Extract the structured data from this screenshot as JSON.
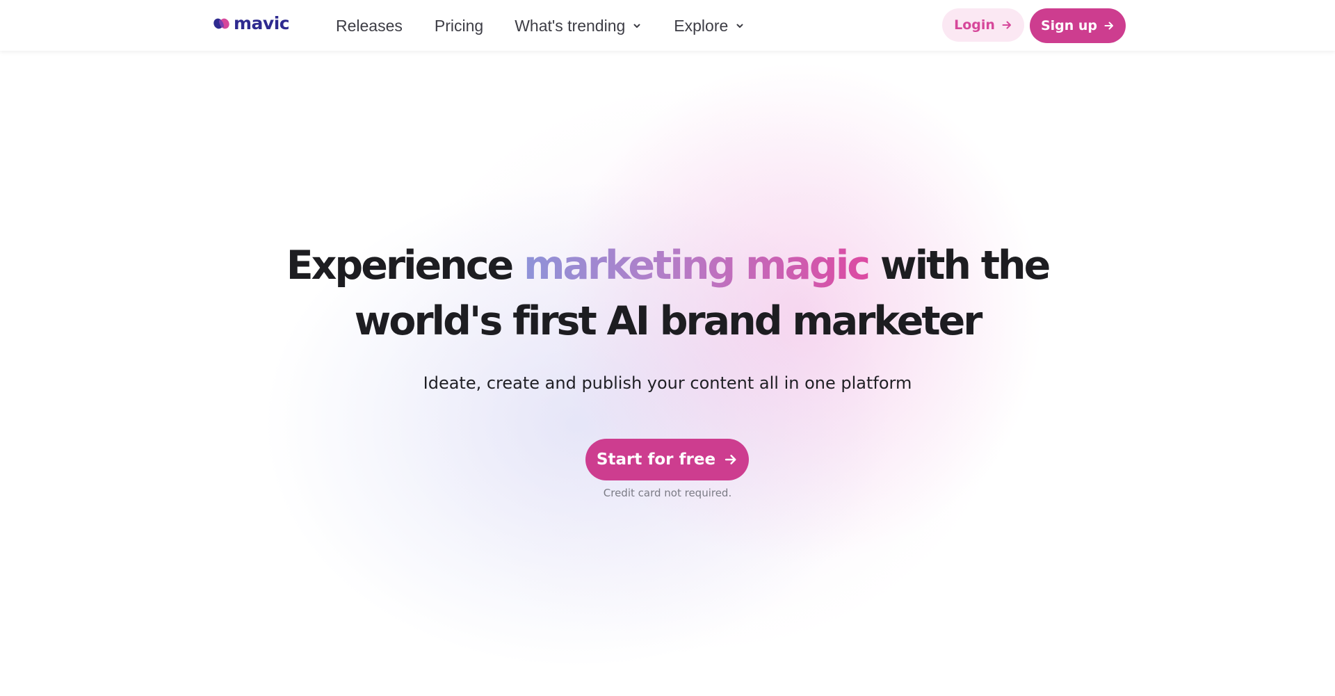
{
  "brand": {
    "name": "mavic",
    "logo_icon": "mavic-logo-mark",
    "colors": {
      "primary": "#cd3d8f",
      "primary_soft": "#fbe8f3",
      "logo_text": "#2e2a8f",
      "gradient_start": "#8e93d8",
      "gradient_end": "#dc4aa2"
    }
  },
  "nav": {
    "items": [
      {
        "label": "Releases",
        "has_dropdown": false
      },
      {
        "label": "Pricing",
        "has_dropdown": false
      },
      {
        "label": "What's trending",
        "has_dropdown": true,
        "icon": "chevron-down-icon"
      },
      {
        "label": "Explore",
        "has_dropdown": true,
        "icon": "chevron-down-icon"
      }
    ],
    "login_label": "Login",
    "signup_label": "Sign up",
    "button_icon": "arrow-right-icon"
  },
  "hero": {
    "title_part1": "Experience",
    "title_highlight": "marketing magic",
    "title_part2": "with the",
    "title_line2": "world's first AI brand marketer",
    "subtitle": "Ideate, create and publish your content all in one platform",
    "cta_label": "Start for free",
    "cta_icon": "arrow-right-icon",
    "note": "Credit card not required."
  }
}
